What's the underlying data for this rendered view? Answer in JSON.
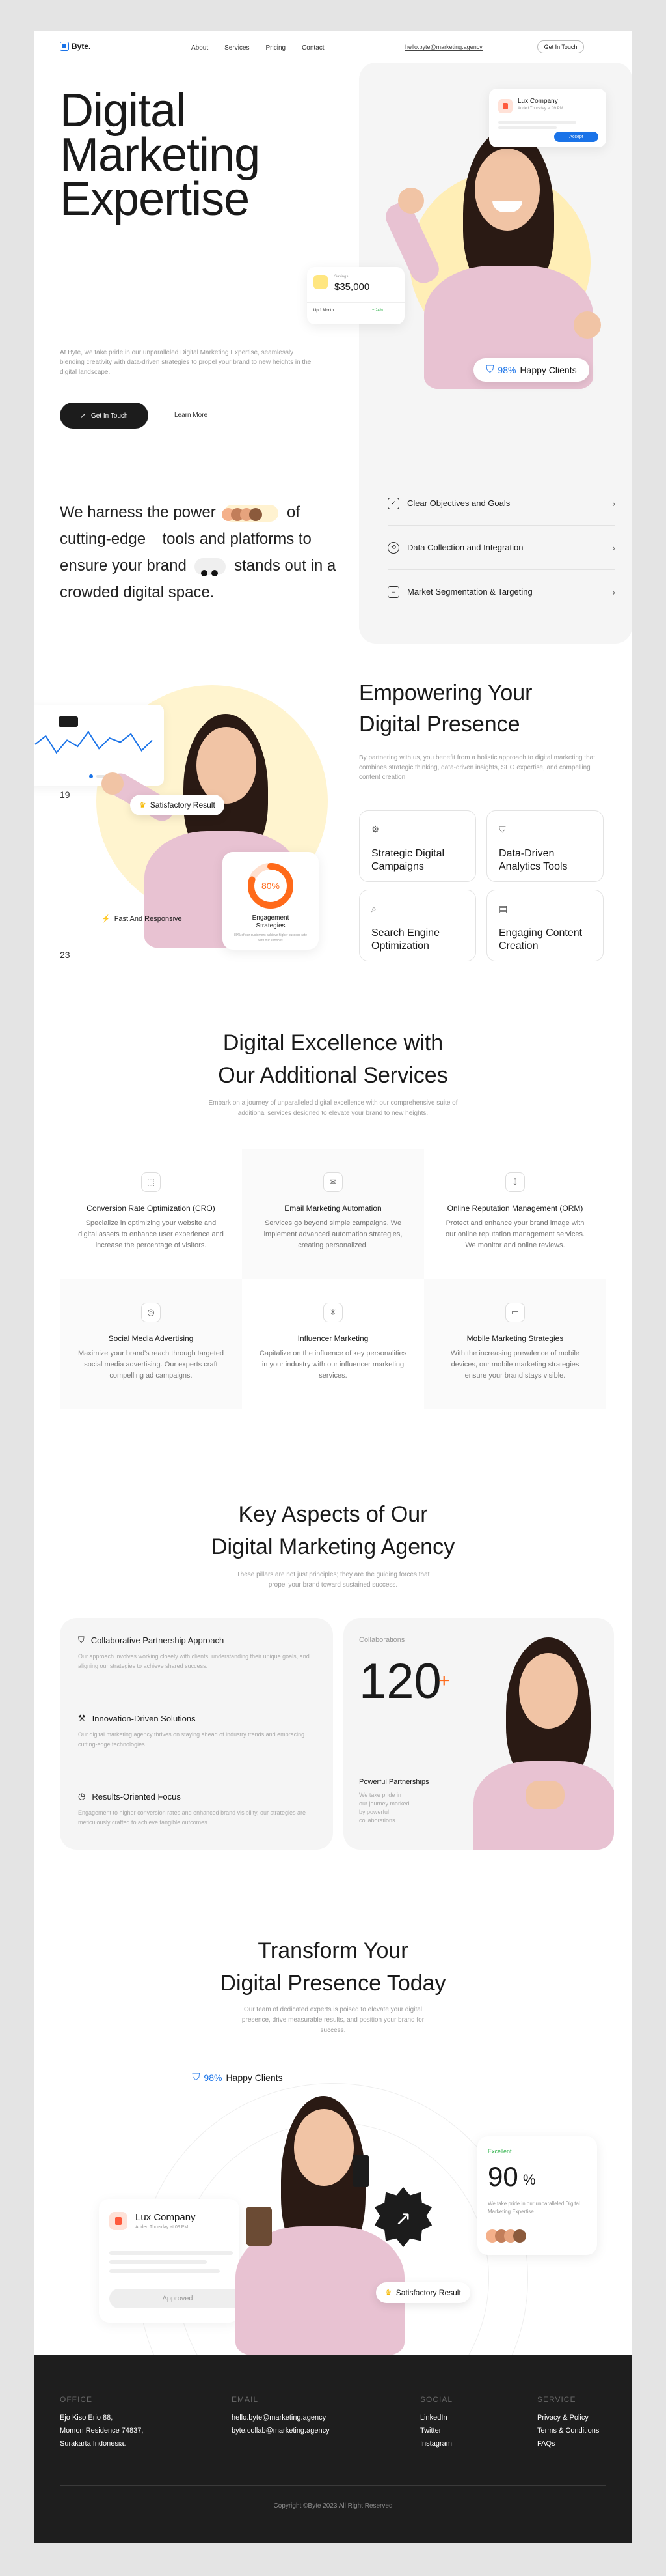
{
  "nav": {
    "brand": "Byte.",
    "links": [
      "About",
      "Services",
      "Pricing",
      "Contact"
    ],
    "email": "hello.byte@marketing.agency",
    "cta": "Get In Touch"
  },
  "hero": {
    "title": "Digital\nMarketing\nExpertise",
    "desc": "At Byte, we take pride in our unparalleled Digital Marketing Expertise, seamlessly blending creativity with data-driven strategies to propel your brand to new heights in the digital landscape.",
    "desc_brand": "Byte",
    "primary_cta": "Get In Touch",
    "secondary_cta": "Learn More",
    "harness_parts": [
      "We harness the power",
      "of",
      "cutting-edge",
      "tools and platforms",
      "to ensure your brand",
      "stands",
      "out in a crowded digital space."
    ],
    "lux_card": {
      "name": "Lux Company",
      "sub": "Added Thursday at 09 PM",
      "button": "Accept"
    },
    "stat_card": {
      "label": "Savings",
      "value": "$35,000",
      "foot_left": "Up 1 Month",
      "foot_right": "+ 24%"
    },
    "happy_value": "98%",
    "happy_label": "Happy Clients",
    "list": [
      {
        "icon": "checklist-icon",
        "label": "Clear Objectives and Goals"
      },
      {
        "icon": "data-icon",
        "label": "Data Collection and Integration"
      },
      {
        "icon": "segment-icon",
        "label": "Market Segmentation & Targeting"
      }
    ]
  },
  "empower": {
    "title_1": "Empowering Your",
    "title_2": "Digital Presence",
    "desc": "By partnering with us, you benefit from a holistic approach to digital marketing that combines strategic thinking, data-driven insights, SEO expertise, and compelling content creation.",
    "cards": [
      "Strategic Digital Campaigns",
      "Data-Driven Analytics Tools",
      "Search Engine Optimization",
      "Engaging Content Creation"
    ],
    "num_top": "19",
    "num_bottom": "23",
    "satisfactory": "Satisfactory Result",
    "fast": "Fast And Responsive",
    "engagement_value": "80%",
    "engagement_title": "Engagement Strategies",
    "engagement_desc": "80% of our customers achieve higher success rate with our services",
    "chart_line_values": [
      22,
      30,
      14,
      26,
      20,
      34,
      18,
      28,
      24,
      32,
      16,
      26
    ]
  },
  "services": {
    "title_1": "Digital Excellence with",
    "title_2": "Our Additional Services",
    "desc": "Embark on a journey of unparalleled digital excellence with our comprehensive suite of additional services designed to elevate your brand to new heights.",
    "items": [
      {
        "icon": "cro-icon",
        "title": "Conversion Rate Optimization (CRO)",
        "desc": "Specialize in optimizing your website and digital assets to enhance user experience and increase the percentage of visitors."
      },
      {
        "icon": "email-icon",
        "title": "Email Marketing Automation",
        "desc": "Services go beyond simple campaigns. We implement advanced automation strategies, creating personalized."
      },
      {
        "icon": "orm-icon",
        "title": "Online Reputation Management (ORM)",
        "desc": "Protect and enhance your brand image with our online reputation management services. We monitor and online reviews."
      },
      {
        "icon": "social-icon",
        "title": "Social Media Advertising",
        "desc": "Maximize your brand's reach through targeted social media advertising. Our experts craft compelling ad campaigns."
      },
      {
        "icon": "influencer-icon",
        "title": "Influencer Marketing",
        "desc": "Capitalize on the influence of key personalities in your industry with our influencer marketing services."
      },
      {
        "icon": "mobile-icon",
        "title": "Mobile Marketing Strategies",
        "desc": "With the increasing prevalence of mobile devices, our mobile marketing strategies ensure your brand stays visible."
      }
    ]
  },
  "aspects": {
    "title_1": "Key Aspects of Our",
    "title_2": "Digital Marketing Agency",
    "desc": "These pillars are not just principles; they are the guiding forces that propel your brand toward sustained success.",
    "items": [
      {
        "icon": "partnership-icon",
        "title": "Collaborative Partnership Approach",
        "desc": "Our approach involves working closely with clients, understanding their unique goals, and aligning our strategies to achieve shared success."
      },
      {
        "icon": "innovation-icon",
        "title": "Innovation-Driven Solutions",
        "desc": "Our digital marketing agency thrives on staying ahead of industry trends and embracing cutting-edge technologies."
      },
      {
        "icon": "focus-icon",
        "title": "Results-Oriented Focus",
        "desc": "Engagement to higher conversion rates and enhanced brand visibility, our strategies are meticulously crafted to achieve tangible outcomes."
      }
    ],
    "collab_label": "Collaborations",
    "collab_value": "120",
    "collab_plus": "+",
    "collab_title": "Powerful Partnerships",
    "collab_desc": "We take pride in our journey marked by powerful collaborations."
  },
  "transform": {
    "title_1": "Transform Your",
    "title_2": "Digital Presence Today",
    "desc": "Our team of dedicated experts is poised to elevate your digital presence, drive measurable results, and position your brand for success.",
    "happy_value": "98%",
    "happy_label": "Happy Clients",
    "excel_label": "Excellent",
    "excel_value": "90",
    "excel_unit": "%",
    "excel_desc": "We take pride in our unparalleled Digital Marketing Expertise.",
    "lux_name": "Lux Company",
    "lux_sub": "Added Thursday at 09 PM",
    "lux_button": "Approved",
    "satisfactory": "Satisfactory Result"
  },
  "footer": {
    "office_head": "OFFICE",
    "office_lines": [
      "Ejo Kiso Erio 88,",
      "Momon Residence 74837,",
      "Surakarta Indonesia."
    ],
    "email_head": "EMAIL",
    "emails": [
      "hello.byte@marketing.agency",
      "byte.collab@marketing.agency"
    ],
    "social_head": "SOCIAL",
    "social": [
      "LinkedIn",
      "Twitter",
      "Instagram"
    ],
    "service_head": "SERVICE",
    "service": [
      "Privacy & Policy",
      "Terms & Conditions",
      "FAQs"
    ],
    "copyright": "Copyright ©Byte 2023 All Right Reserved"
  },
  "colors": {
    "accent": "#1a73e8",
    "dark": "#1c1c1c",
    "yellow": "#ffeeb6",
    "orange": "#ff6a1a",
    "green": "#2eb24a"
  }
}
